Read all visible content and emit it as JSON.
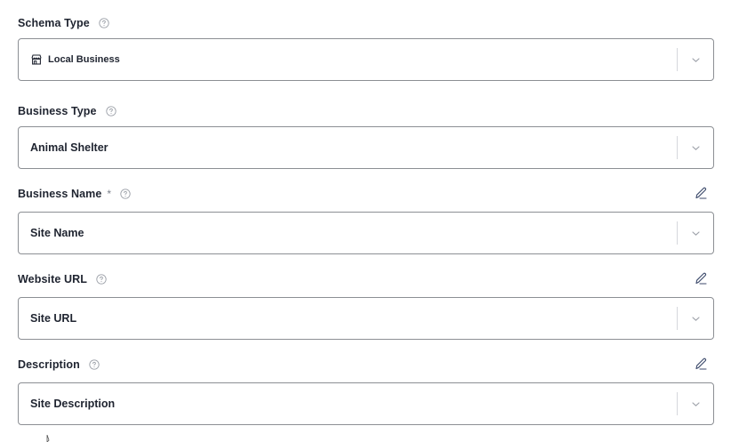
{
  "fields": [
    {
      "label": "Schema Type",
      "required": false,
      "editable": false,
      "value": "Local Business",
      "value_icon": "store-icon"
    },
    {
      "label": "Business Type",
      "required": false,
      "editable": false,
      "value": "Animal Shelter"
    },
    {
      "label": "Business Name",
      "required": true,
      "required_mark": "*",
      "editable": true,
      "value": "Site Name"
    },
    {
      "label": "Website URL",
      "required": false,
      "editable": true,
      "value": "Site URL"
    },
    {
      "label": "Description",
      "required": false,
      "editable": true,
      "value": "Site Description"
    }
  ],
  "icons": {
    "help": "question-circle-icon",
    "edit": "pencil-icon",
    "dropdown": "chevron-down-icon",
    "store": "store-icon"
  },
  "colors": {
    "border": "#8c8f94",
    "text": "#1f2430",
    "muted": "#9ca0a8",
    "separator": "#d5d7dc",
    "edit_icon": "#3c4a6b"
  }
}
